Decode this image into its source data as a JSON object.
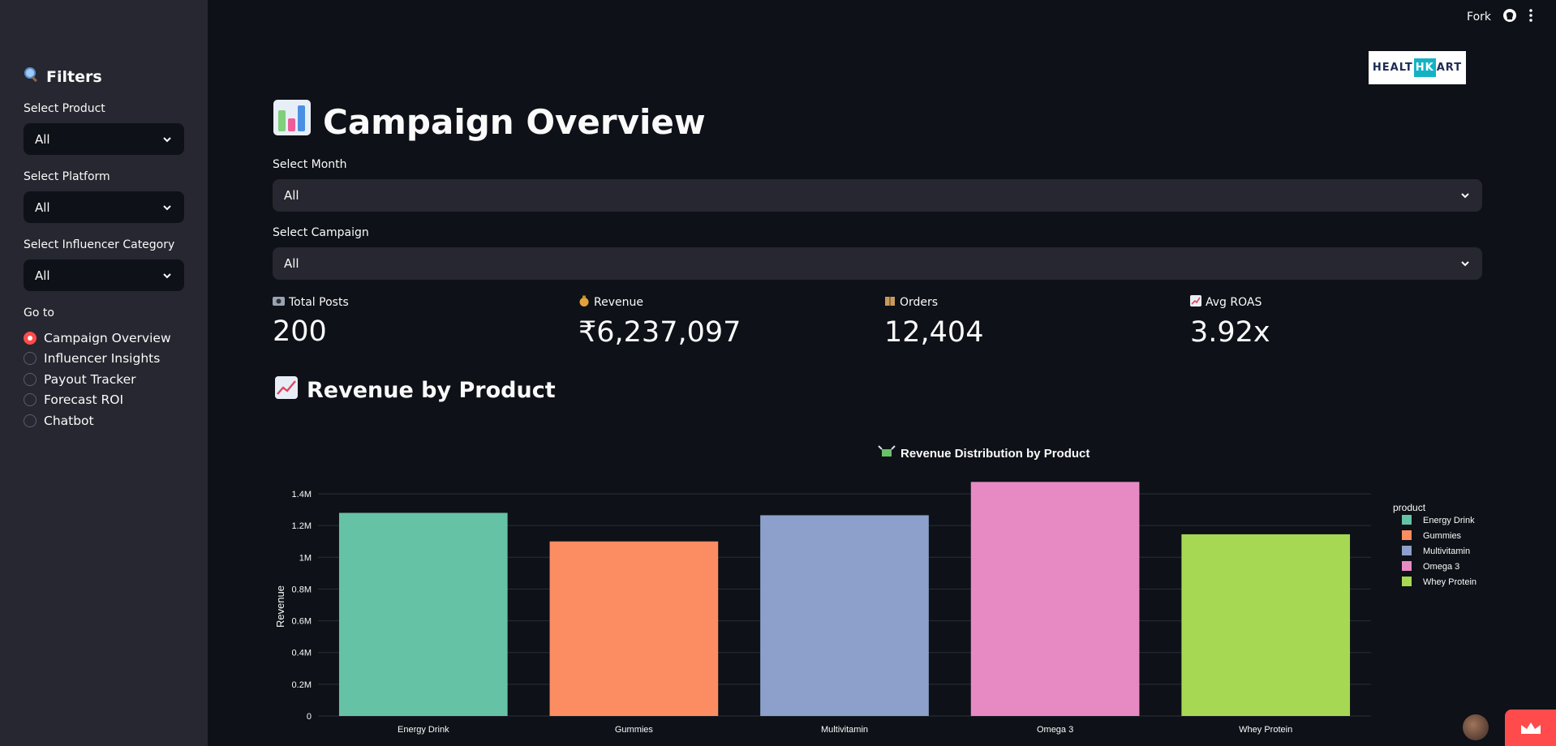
{
  "sidebar": {
    "title": "Filters",
    "title_icon": "magnifier-icon",
    "filters": [
      {
        "label": "Select Product",
        "value": "All"
      },
      {
        "label": "Select Platform",
        "value": "All"
      },
      {
        "label": "Select Influencer Category",
        "value": "All"
      }
    ],
    "nav_label": "Go to",
    "nav_items": [
      "Campaign Overview",
      "Influencer Insights",
      "Payout Tracker",
      "Forecast ROI",
      "Chatbot"
    ],
    "nav_selected": "Campaign Overview"
  },
  "topbar": {
    "fork_label": "Fork"
  },
  "logo": {
    "part1": "HEALT",
    "part2": "HK",
    "part3": "ART"
  },
  "page": {
    "title": "Campaign Overview",
    "month_label": "Select Month",
    "month_value": "All",
    "campaign_label": "Select Campaign",
    "campaign_value": "All"
  },
  "metrics": [
    {
      "label": "Total Posts",
      "value": "200",
      "icon": "camera-icon"
    },
    {
      "label": "Revenue",
      "value": "₹6,237,097",
      "icon": "money-bag-icon"
    },
    {
      "label": "Orders",
      "value": "12,404",
      "icon": "package-icon"
    },
    {
      "label": "Avg ROAS",
      "value": "3.92x",
      "icon": "chart-up-icon"
    }
  ],
  "section": {
    "title": "Revenue by Product"
  },
  "colors": {
    "accent": "#ff4b4b",
    "bg": "#0e1117",
    "sidebar_bg": "#262730"
  },
  "chart_data": {
    "type": "bar",
    "title": "Revenue Distribution by Product",
    "title_icon": "money-wings-icon",
    "categories": [
      "Energy Drink",
      "Gummies",
      "Multivitamin",
      "Omega 3",
      "Whey Protein"
    ],
    "values": [
      1280000,
      1100000,
      1265000,
      1475000,
      1145000
    ],
    "colors": [
      "#66c2a5",
      "#fc8d62",
      "#8da0cb",
      "#e78ac3",
      "#a6d854"
    ],
    "ylabel": "Revenue",
    "xlabel": "",
    "ylim": [
      0,
      1400000
    ],
    "yticks": [
      0,
      200000,
      400000,
      600000,
      800000,
      1000000,
      1200000,
      1400000
    ],
    "ytick_labels": [
      "0",
      "0.2M",
      "0.4M",
      "0.6M",
      "0.8M",
      "1M",
      "1.2M",
      "1.4M"
    ],
    "legend_title": "product",
    "legend_position": "right",
    "grid": true
  }
}
